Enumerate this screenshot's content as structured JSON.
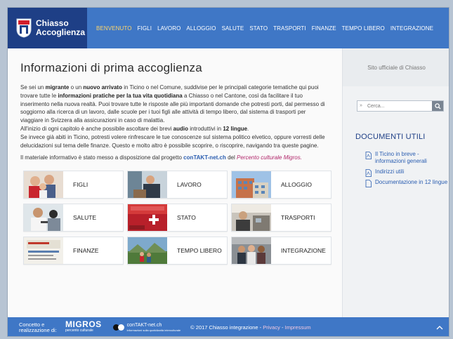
{
  "header": {
    "logo_line1": "Chiasso",
    "logo_line2": "Accoglienza",
    "nav": [
      {
        "label": "BENVENUTO",
        "active": true
      },
      {
        "label": "FIGLI"
      },
      {
        "label": "LAVORO"
      },
      {
        "label": "ALLOGGIO"
      },
      {
        "label": "SALUTE"
      },
      {
        "label": "STATO"
      },
      {
        "label": "TRASPORTI"
      },
      {
        "label": "FINANZE"
      },
      {
        "label": "TEMPO LIBERO"
      },
      {
        "label": "INTEGRAZIONE"
      }
    ]
  },
  "main": {
    "title": "Informazioni di prima accoglienza",
    "p1_a": "Se sei un ",
    "p1_b": "migrante",
    "p1_c": " o un ",
    "p1_d": "nuovo arrivato",
    "p1_e": " in Ticino o nel Comune, suddivise per le principali categorie tematiche qui puoi trovare tutte le ",
    "p1_f": "informazioni pratiche per la tua vita quotidiana",
    "p1_g": " a Chiasso o nel Cantone, così da facilitare il tuo inserimento nella nuova realtà. Puoi trovare tutte le risposte alle più importanti domande che potresti porti, dal permesso di soggiorno alla ricerca di un lavoro, dalle scuole per i tuoi figli alle attività di tempo libero, dal sistema di trasporti per viaggiare in Svizzera alla assicurazioni in caso di malattia.",
    "p2_a": "All'inizio di ogni capitolo è anche possibile ascoltare dei brevi ",
    "p2_b": "audio",
    "p2_c": " introduttivi in ",
    "p2_d": "12 lingue",
    "p2_e": ".",
    "p3": "Se invece già abiti in Ticino, potresti volere rinfrescare le tue conoscenze sul sistema politico elvetico, oppure vorresti delle delucidazioni sul tema delle finanze. Questo e molto altro è possibile scoprire, o riscoprire, navigando tra queste pagine.",
    "p4_a": "Il materiale informativo è stato messo a disposizione dal progetto ",
    "p4_link": "conTAKT-net.ch",
    "p4_b": " del ",
    "p4_c": "Percento culturale Migros."
  },
  "tiles": [
    {
      "label": "FIGLI"
    },
    {
      "label": "LAVORO"
    },
    {
      "label": "ALLOGGIO"
    },
    {
      "label": "SALUTE"
    },
    {
      "label": "STATO"
    },
    {
      "label": "TRASPORTI"
    },
    {
      "label": "FINANZE"
    },
    {
      "label": "TEMPO LIBERO"
    },
    {
      "label": "INTEGRAZIONE"
    }
  ],
  "sidebar": {
    "official": "Sito ufficiale di Chiasso",
    "search_placeholder": "Cerca...",
    "search_prefix": "»",
    "docs_title": "DOCUMENTI UTILI",
    "docs": [
      {
        "label": "Il Ticino in breve - informazioni generali"
      },
      {
        "label": "Indirizzi utili"
      },
      {
        "label": "Documentazione in 12 lingue"
      }
    ]
  },
  "footer": {
    "concept": "Concetto e realizzazione di:",
    "migros": "MIGROS",
    "migros_sub": "percento culturale",
    "contakt": "conTAKT-net.ch",
    "contakt_sub": "informazioni sulla quotidianità interculturale",
    "copyright": "© 2017 Chiasso integrazione - ",
    "privacy": "Privacy",
    "sep": " - ",
    "impressum": "Impressum"
  },
  "colors": {
    "header_blue": "#3f77c6",
    "logo_navy": "#1e3f86",
    "active_nav": "#ffd66b",
    "link": "#2a5db0",
    "migros_pink": "#b0266a"
  }
}
